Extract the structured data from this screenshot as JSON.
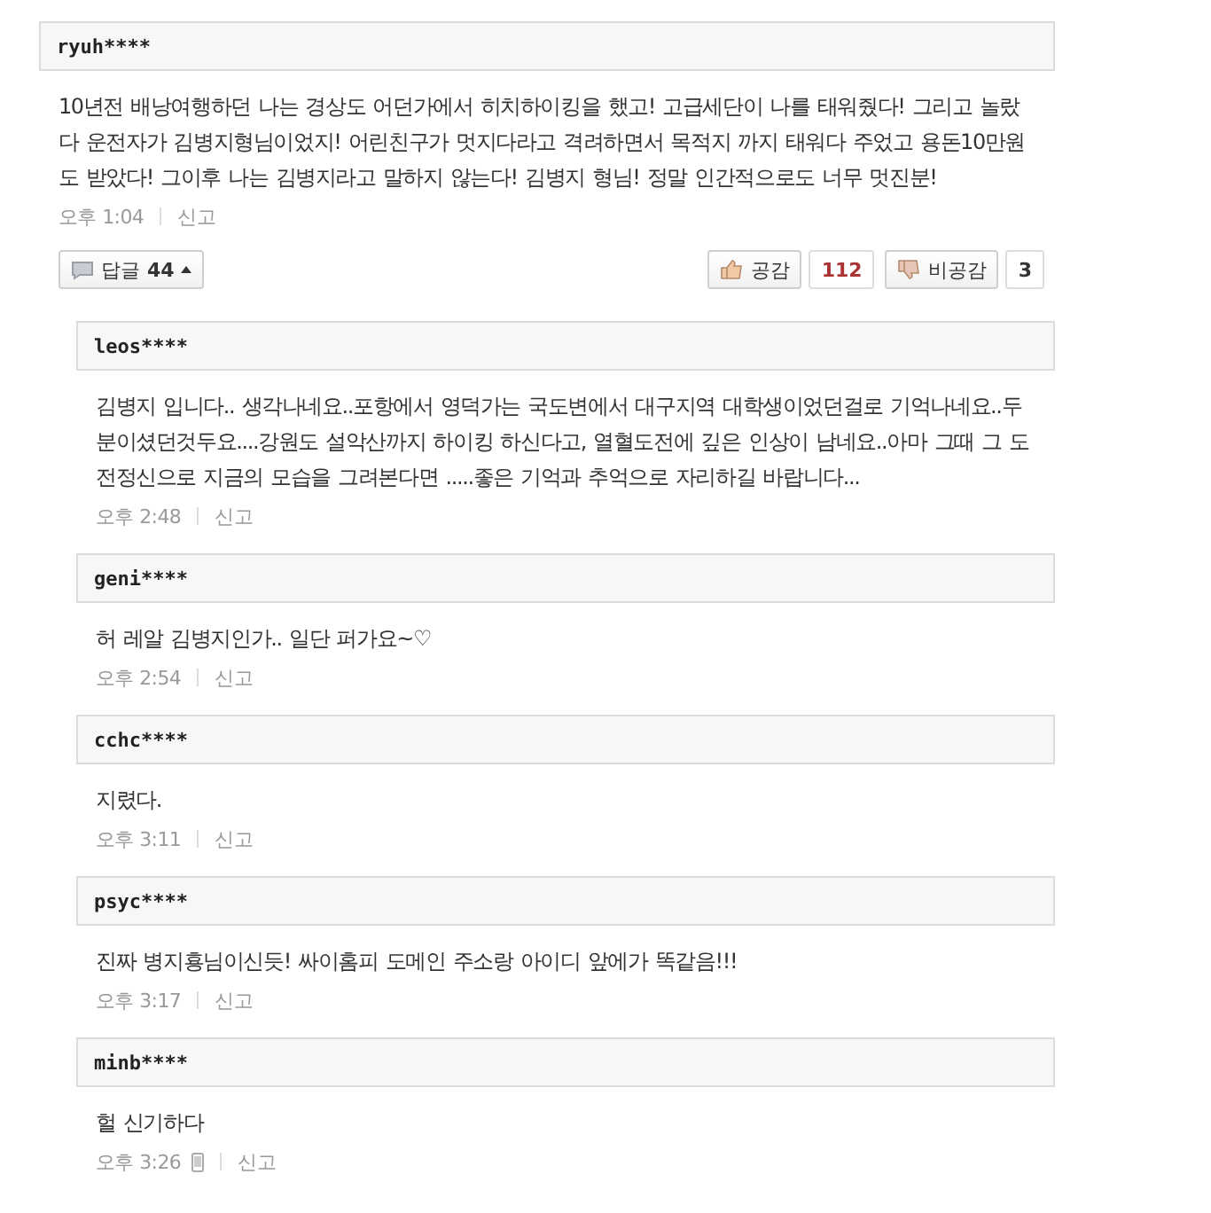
{
  "comment": {
    "author": "ryuh****",
    "text": "10년전 배낭여행하던 나는 경상도 어던가에서 히치하이킹을 했고! 고급세단이 나를 태워줬다! 그리고 놀랐다 운전자가 김병지형님이었지! 어린친구가 멋지다라고 격려하면서 목적지 까지 태워다 주었고 용돈10만원도 받았다! 그이후 나는 김병지라고 말하지 않는다! 김병지 형님! 정말 인간적으로도 너무 멋진분!",
    "time": "오후 1:04",
    "mobile": false,
    "report": "신고",
    "reply_button": {
      "label": "답글",
      "count": "44",
      "expanded": true
    },
    "like": {
      "label": "공감",
      "count": "112"
    },
    "dislike": {
      "label": "비공감",
      "count": "3"
    }
  },
  "replies": [
    {
      "author": "leos****",
      "text": "김병지 입니다.. 생각나네요..포항에서 영덕가는 국도변에서 대구지역 대학생이었던걸로 기억나네요..두분이셨던것두요....강원도 설악산까지 하이킹 하신다고, 열혈도전에 깊은 인상이 남네요..아마 그때 그 도전정신으로 지금의 모습을 그려본다면 .....좋은 기억과 추억으로 자리하길 바랍니다...",
      "time": "오후 2:48",
      "mobile": false,
      "report": "신고"
    },
    {
      "author": "geni****",
      "text": "허 레알 김병지인가.. 일단 퍼가요~♡",
      "time": "오후 2:54",
      "mobile": false,
      "report": "신고"
    },
    {
      "author": "cchc****",
      "text": "지렸다.",
      "time": "오후 3:11",
      "mobile": false,
      "report": "신고"
    },
    {
      "author": "psyc****",
      "text": "진짜 병지횽님이신듯! 싸이홈피 도메인 주소랑 아이디 앞에가 똑같음!!!",
      "time": "오후 3:17",
      "mobile": false,
      "report": "신고"
    },
    {
      "author": "minb****",
      "text": "헐 신기하다",
      "time": "오후 3:26",
      "mobile": true,
      "report": "신고"
    }
  ]
}
